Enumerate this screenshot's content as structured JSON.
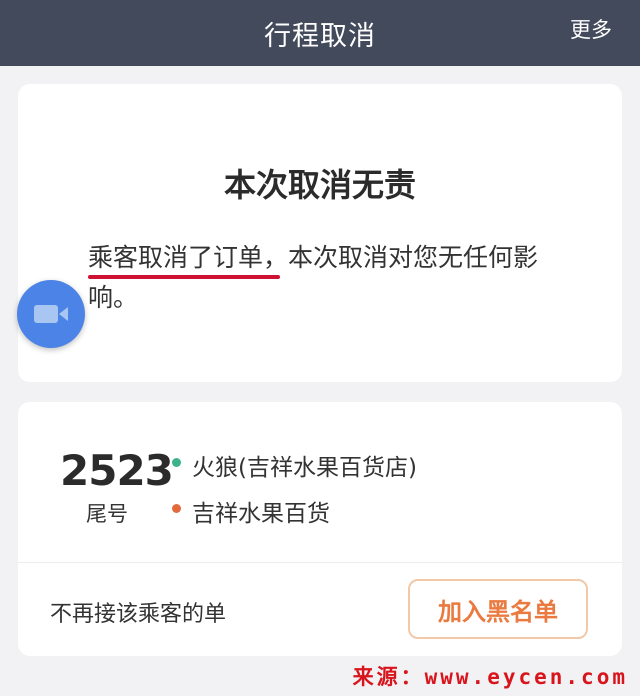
{
  "header": {
    "title": "行程取消",
    "more_label": "更多"
  },
  "status_card": {
    "title": "本次取消无责",
    "description": "乘客取消了订单，本次取消对您无任何影响。",
    "highlight_color": "#cf1133"
  },
  "floating": {
    "icon": "video-camera-icon",
    "color": "#4c83e6"
  },
  "trip_card": {
    "tail_number": "2523",
    "tail_label": "尾号",
    "start_place": "火狼(吉祥水果百货店)",
    "end_place": "吉祥水果百货",
    "start_dot_color": "#3cb38a",
    "end_dot_color": "#e26a3c",
    "block_label": "不再接该乘客的单",
    "blacklist_button": "加入黑名单"
  },
  "watermark": "来源：www.eycen.com",
  "colors": {
    "navbar": "#424a5c",
    "accent": "#ea7a3f",
    "background": "#f2f2f4"
  }
}
